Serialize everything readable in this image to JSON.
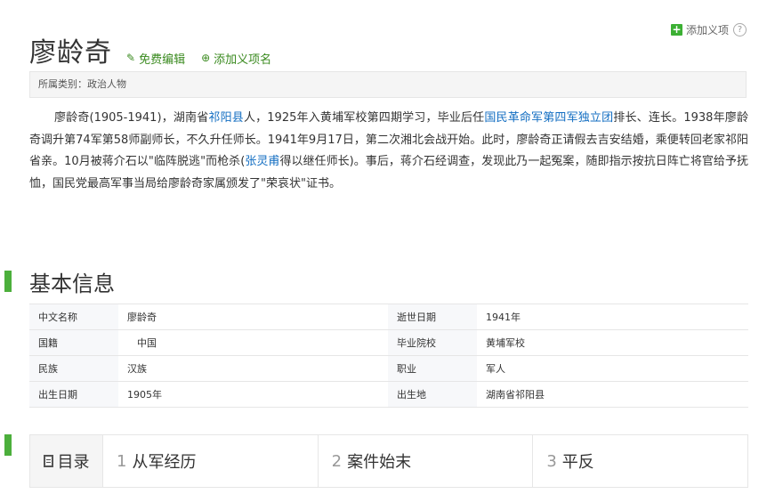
{
  "header": {
    "add_sense_label": "添加义项",
    "help_glyph": "?",
    "title": "廖龄奇",
    "edit_label": "免费编辑",
    "add_name_label": "添加义项名"
  },
  "category": "所属类别：政治人物",
  "summary": {
    "p1": "廖龄奇(1905-1941)，湖南省",
    "link1": "祁阳县",
    "p2": "人，1925年入黄埔军校第四期学习，毕业后任",
    "link2": "国民革命军第四军独立团",
    "p3": "排长、连长。1938年廖龄奇调升第74军第58师副师长，不久升任师长。1941年9月17日，第二次湘北会战开始。此时，廖龄奇正请假去吉安结婚，乘便转回老家祁阳省亲。10月被蒋介石以\"临阵脱逃\"而枪杀(",
    "link3": "张灵甫",
    "p4": "得以继任师长)。事后，蒋介石经调查，发现此乃一起冤案，随即指示按抗日阵亡将官给予抚恤，国民党最高军事当局给廖龄奇家属颁发了\"荣哀状\"证书。"
  },
  "basic_info": {
    "title": "基本信息",
    "rows": [
      {
        "k1": "中文名称",
        "v1": "廖龄奇",
        "k2": "逝世日期",
        "v2": "1941年"
      },
      {
        "k1": "国籍",
        "v1": "　中国",
        "k2": "毕业院校",
        "v2": "黄埔军校"
      },
      {
        "k1": "民族",
        "v1": "汉族",
        "k2": "职业",
        "v2": "军人"
      },
      {
        "k1": "出生日期",
        "v1": "1905年",
        "k2": "出生地",
        "v2": "湖南省祁阳县"
      }
    ]
  },
  "toc": {
    "label": "目录",
    "items": [
      {
        "num": "1",
        "label": "从军经历"
      },
      {
        "num": "2",
        "label": "案件始末"
      },
      {
        "num": "3",
        "label": "平反"
      }
    ]
  },
  "colors": {
    "accent_green": "#4caf3c",
    "link_blue": "#136ec2"
  }
}
